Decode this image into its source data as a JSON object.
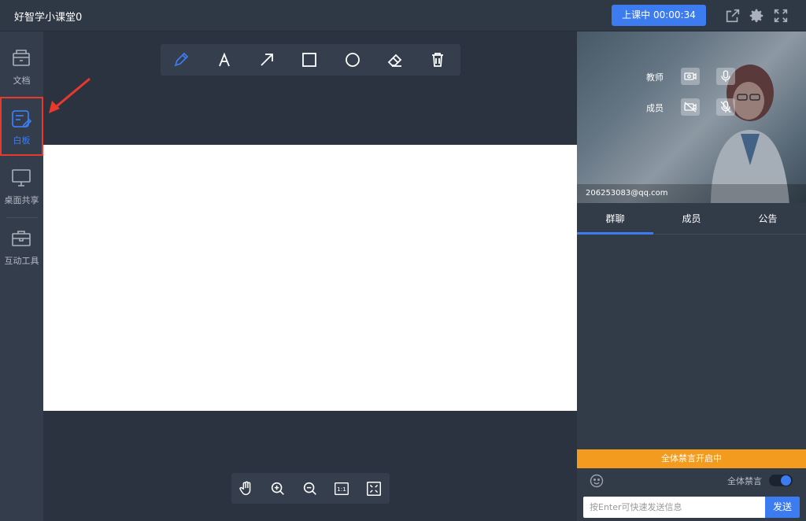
{
  "app": {
    "title": "好智学小课堂0"
  },
  "header": {
    "live_button": "上课中 00:00:34",
    "icons": [
      "share-icon",
      "gear-icon",
      "fullscreen-icon"
    ]
  },
  "sidebar": {
    "items": [
      {
        "label": "文档",
        "icon": "document-icon"
      },
      {
        "label": "白板",
        "icon": "whiteboard-icon",
        "active": true
      },
      {
        "label": "桌面共享",
        "icon": "monitor-icon"
      },
      {
        "label": "互动工具",
        "icon": "toolbox-icon"
      }
    ]
  },
  "draw_tools": [
    "pen-icon",
    "text-icon",
    "arrow-icon",
    "rectangle-icon",
    "circle-icon",
    "eraser-icon",
    "trash-icon"
  ],
  "zoom_tools": {
    "icons": [
      "hand-icon",
      "zoom-in-icon",
      "zoom-out-icon",
      "actual-size-icon",
      "fit-screen-icon"
    ],
    "actual_size_label": "1:1"
  },
  "video": {
    "teacher_label": "教师",
    "member_label": "成员",
    "email": "206253083@qq.com"
  },
  "tabs": [
    {
      "label": "群聊",
      "active": true
    },
    {
      "label": "成员"
    },
    {
      "label": "公告"
    }
  ],
  "chat": {
    "mute_banner": "全体禁言开启中",
    "mute_all_label": "全体禁言",
    "mute_all_on": true,
    "input_placeholder": "按Enter可快速发送信息",
    "send_label": "发送"
  },
  "colors": {
    "accent": "#3d7cf0",
    "banner": "#f29b1f",
    "highlight": "#e8392b"
  }
}
